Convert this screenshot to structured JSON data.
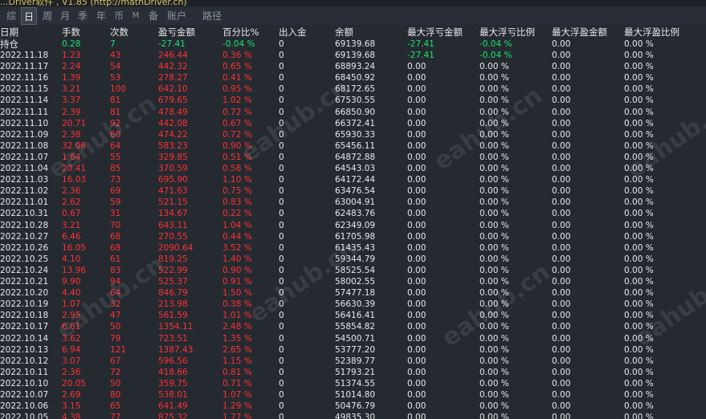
{
  "window": {
    "title": "...Driver软件 , V1.85 (http://mathDriver.cn)"
  },
  "tabs": [
    {
      "label": "综",
      "active": false
    },
    {
      "label": "日",
      "active": true
    },
    {
      "label": "周",
      "active": false
    },
    {
      "label": "月",
      "active": false
    },
    {
      "label": "季",
      "active": false
    },
    {
      "label": "年",
      "active": false
    },
    {
      "label": "币",
      "active": false
    },
    {
      "label": "M",
      "active": false
    },
    {
      "label": "备",
      "active": false
    },
    {
      "label": "账户",
      "active": false
    },
    {
      "label": "路径",
      "active": false
    }
  ],
  "columns": [
    "日期",
    "手数",
    "次数",
    "盈亏金额",
    "百分比%",
    "出入金",
    "余额",
    "最大浮亏金额",
    "最大浮亏比例",
    "最大浮盈金额",
    "最大浮盈比例"
  ],
  "holding_row": {
    "label": "持仓",
    "lots": "0.28",
    "count": "7",
    "pnl": "-27.41",
    "pct": "-0.04 %",
    "inout": "0",
    "balance": "69139.68",
    "max_loss_amt": "-27.41",
    "max_loss_pct": "-0.04 %",
    "max_gain_amt": "0.00",
    "max_gain_pct": "0.00 %"
  },
  "rows": [
    {
      "date": "2022.11.18",
      "lots": "1.23",
      "count": "43",
      "pnl": "246.44",
      "pct": "0.36 %",
      "inout": "0",
      "balance": "69139.68",
      "max_loss_amt": "-27.41",
      "max_loss_pct": "-0.04 %",
      "max_gain_amt": "0.00",
      "max_gain_pct": "0.00 %"
    },
    {
      "date": "2022.11.17",
      "lots": "2.24",
      "count": "54",
      "pnl": "442.32",
      "pct": "0.65 %",
      "inout": "0",
      "balance": "68893.24",
      "max_loss_amt": "0.00",
      "max_loss_pct": "0.00 %",
      "max_gain_amt": "0.00",
      "max_gain_pct": "0.00 %"
    },
    {
      "date": "2022.11.16",
      "lots": "1.39",
      "count": "53",
      "pnl": "278.27",
      "pct": "0.41 %",
      "inout": "0",
      "balance": "68450.92",
      "max_loss_amt": "0.00",
      "max_loss_pct": "0.00 %",
      "max_gain_amt": "0.00",
      "max_gain_pct": "0.00 %"
    },
    {
      "date": "2022.11.15",
      "lots": "3.21",
      "count": "100",
      "pnl": "642.10",
      "pct": "0.95 %",
      "inout": "0",
      "balance": "68172.65",
      "max_loss_amt": "0.00",
      "max_loss_pct": "0.00 %",
      "max_gain_amt": "0.00",
      "max_gain_pct": "0.00 %"
    },
    {
      "date": "2022.11.14",
      "lots": "3.37",
      "count": "81",
      "pnl": "679.65",
      "pct": "1.02 %",
      "inout": "0",
      "balance": "67530.55",
      "max_loss_amt": "0.00",
      "max_loss_pct": "0.00 %",
      "max_gain_amt": "0.00",
      "max_gain_pct": "0.00 %"
    },
    {
      "date": "2022.11.11",
      "lots": "2.39",
      "count": "81",
      "pnl": "478.49",
      "pct": "0.72 %",
      "inout": "0",
      "balance": "66850.90",
      "max_loss_amt": "0.00",
      "max_loss_pct": "0.00 %",
      "max_gain_amt": "0.00",
      "max_gain_pct": "0.00 %"
    },
    {
      "date": "2022.11.10",
      "lots": "20.71",
      "count": "92",
      "pnl": "442.08",
      "pct": "0.67 %",
      "inout": "0",
      "balance": "66372.41",
      "max_loss_amt": "0.00",
      "max_loss_pct": "0.00 %",
      "max_gain_amt": "0.00",
      "max_gain_pct": "0.00 %"
    },
    {
      "date": "2022.11.09",
      "lots": "2.38",
      "count": "60",
      "pnl": "474.22",
      "pct": "0.72 %",
      "inout": "0",
      "balance": "65930.33",
      "max_loss_amt": "0.00",
      "max_loss_pct": "0.00 %",
      "max_gain_amt": "0.00",
      "max_gain_pct": "0.00 %"
    },
    {
      "date": "2022.11.08",
      "lots": "32.06",
      "count": "64",
      "pnl": "583.23",
      "pct": "0.90 %",
      "inout": "0",
      "balance": "65456.11",
      "max_loss_amt": "0.00",
      "max_loss_pct": "0.00 %",
      "max_gain_amt": "0.00",
      "max_gain_pct": "0.00 %"
    },
    {
      "date": "2022.11.07",
      "lots": "1.64",
      "count": "55",
      "pnl": "329.85",
      "pct": "0.51 %",
      "inout": "0",
      "balance": "64872.88",
      "max_loss_amt": "0.00",
      "max_loss_pct": "0.00 %",
      "max_gain_amt": "0.00",
      "max_gain_pct": "0.00 %"
    },
    {
      "date": "2022.11.04",
      "lots": "20.41",
      "count": "85",
      "pnl": "370.59",
      "pct": "0.58 %",
      "inout": "0",
      "balance": "64543.03",
      "max_loss_amt": "0.00",
      "max_loss_pct": "0.00 %",
      "max_gain_amt": "0.00",
      "max_gain_pct": "0.00 %"
    },
    {
      "date": "2022.11.03",
      "lots": "16.03",
      "count": "73",
      "pnl": "695.90",
      "pct": "1.10 %",
      "inout": "0",
      "balance": "64172.44",
      "max_loss_amt": "0.00",
      "max_loss_pct": "0.00 %",
      "max_gain_amt": "0.00",
      "max_gain_pct": "0.00 %"
    },
    {
      "date": "2022.11.02",
      "lots": "2.36",
      "count": "69",
      "pnl": "471.63",
      "pct": "0.75 %",
      "inout": "0",
      "balance": "63476.54",
      "max_loss_amt": "0.00",
      "max_loss_pct": "0.00 %",
      "max_gain_amt": "0.00",
      "max_gain_pct": "0.00 %"
    },
    {
      "date": "2022.11.01",
      "lots": "2.62",
      "count": "59",
      "pnl": "521.15",
      "pct": "0.83 %",
      "inout": "0",
      "balance": "63004.91",
      "max_loss_amt": "0.00",
      "max_loss_pct": "0.00 %",
      "max_gain_amt": "0.00",
      "max_gain_pct": "0.00 %"
    },
    {
      "date": "2022.10.31",
      "lots": "0.67",
      "count": "31",
      "pnl": "134.67",
      "pct": "0.22 %",
      "inout": "0",
      "balance": "62483.76",
      "max_loss_amt": "0.00",
      "max_loss_pct": "0.00 %",
      "max_gain_amt": "0.00",
      "max_gain_pct": "0.00 %"
    },
    {
      "date": "2022.10.28",
      "lots": "3.21",
      "count": "70",
      "pnl": "643.11",
      "pct": "1.04 %",
      "inout": "0",
      "balance": "62349.09",
      "max_loss_amt": "0.00",
      "max_loss_pct": "0.00 %",
      "max_gain_amt": "0.00",
      "max_gain_pct": "0.00 %"
    },
    {
      "date": "2022.10.27",
      "lots": "6.46",
      "count": "68",
      "pnl": "270.55",
      "pct": "0.44 %",
      "inout": "0",
      "balance": "61705.98",
      "max_loss_amt": "0.00",
      "max_loss_pct": "0.00 %",
      "max_gain_amt": "0.00",
      "max_gain_pct": "0.00 %"
    },
    {
      "date": "2022.10.26",
      "lots": "16.05",
      "count": "68",
      "pnl": "2090.64",
      "pct": "3.52 %",
      "inout": "0",
      "balance": "61435.43",
      "max_loss_amt": "0.00",
      "max_loss_pct": "0.00 %",
      "max_gain_amt": "0.00",
      "max_gain_pct": "0.00 %"
    },
    {
      "date": "2022.10.25",
      "lots": "4.10",
      "count": "61",
      "pnl": "819.25",
      "pct": "1.40 %",
      "inout": "0",
      "balance": "59344.79",
      "max_loss_amt": "0.00",
      "max_loss_pct": "0.00 %",
      "max_gain_amt": "0.00",
      "max_gain_pct": "0.00 %"
    },
    {
      "date": "2022.10.24",
      "lots": "13.96",
      "count": "83",
      "pnl": "522.99",
      "pct": "0.90 %",
      "inout": "0",
      "balance": "58525.54",
      "max_loss_amt": "0.00",
      "max_loss_pct": "0.00 %",
      "max_gain_amt": "0.00",
      "max_gain_pct": "0.00 %"
    },
    {
      "date": "2022.10.21",
      "lots": "9.90",
      "count": "94",
      "pnl": "525.37",
      "pct": "0.91 %",
      "inout": "0",
      "balance": "58002.55",
      "max_loss_amt": "0.00",
      "max_loss_pct": "0.00 %",
      "max_gain_amt": "0.00",
      "max_gain_pct": "0.00 %"
    },
    {
      "date": "2022.10.20",
      "lots": "4.40",
      "count": "64",
      "pnl": "846.79",
      "pct": "1.50 %",
      "inout": "0",
      "balance": "57477.18",
      "max_loss_amt": "0.00",
      "max_loss_pct": "0.00 %",
      "max_gain_amt": "0.00",
      "max_gain_pct": "0.00 %"
    },
    {
      "date": "2022.10.19",
      "lots": "1.07",
      "count": "32",
      "pnl": "213.98",
      "pct": "0.38 %",
      "inout": "0",
      "balance": "56630.39",
      "max_loss_amt": "0.00",
      "max_loss_pct": "0.00 %",
      "max_gain_amt": "0.00",
      "max_gain_pct": "0.00 %"
    },
    {
      "date": "2022.10.18",
      "lots": "2.95",
      "count": "47",
      "pnl": "561.59",
      "pct": "1.01 %",
      "inout": "0",
      "balance": "56416.41",
      "max_loss_amt": "0.00",
      "max_loss_pct": "0.00 %",
      "max_gain_amt": "0.00",
      "max_gain_pct": "0.00 %"
    },
    {
      "date": "2022.10.17",
      "lots": "6.81",
      "count": "50",
      "pnl": "1354.11",
      "pct": "2.48 %",
      "inout": "0",
      "balance": "55854.82",
      "max_loss_amt": "0.00",
      "max_loss_pct": "0.00 %",
      "max_gain_amt": "0.00",
      "max_gain_pct": "0.00 %"
    },
    {
      "date": "2022.10.14",
      "lots": "3.62",
      "count": "79",
      "pnl": "723.51",
      "pct": "1.35 %",
      "inout": "0",
      "balance": "54500.71",
      "max_loss_amt": "0.00",
      "max_loss_pct": "0.00 %",
      "max_gain_amt": "0.00",
      "max_gain_pct": "0.00 %"
    },
    {
      "date": "2022.10.13",
      "lots": "6.94",
      "count": "121",
      "pnl": "1387.43",
      "pct": "2.65 %",
      "inout": "0",
      "balance": "53777.20",
      "max_loss_amt": "0.00",
      "max_loss_pct": "0.00 %",
      "max_gain_amt": "0.00",
      "max_gain_pct": "0.00 %"
    },
    {
      "date": "2022.10.12",
      "lots": "3.07",
      "count": "67",
      "pnl": "596.56",
      "pct": "1.15 %",
      "inout": "0",
      "balance": "52389.77",
      "max_loss_amt": "0.00",
      "max_loss_pct": "0.00 %",
      "max_gain_amt": "0.00",
      "max_gain_pct": "0.00 %"
    },
    {
      "date": "2022.10.11",
      "lots": "2.36",
      "count": "72",
      "pnl": "418.66",
      "pct": "0.81 %",
      "inout": "0",
      "balance": "51793.21",
      "max_loss_amt": "0.00",
      "max_loss_pct": "0.00 %",
      "max_gain_amt": "0.00",
      "max_gain_pct": "0.00 %"
    },
    {
      "date": "2022.10.10",
      "lots": "20.05",
      "count": "50",
      "pnl": "359.75",
      "pct": "0.71 %",
      "inout": "0",
      "balance": "51374.55",
      "max_loss_amt": "0.00",
      "max_loss_pct": "0.00 %",
      "max_gain_amt": "0.00",
      "max_gain_pct": "0.00 %"
    },
    {
      "date": "2022.10.07",
      "lots": "2.69",
      "count": "80",
      "pnl": "538.01",
      "pct": "1.07 %",
      "inout": "0",
      "balance": "51014.80",
      "max_loss_amt": "0.00",
      "max_loss_pct": "0.00 %",
      "max_gain_amt": "0.00",
      "max_gain_pct": "0.00 %"
    },
    {
      "date": "2022.10.06",
      "lots": "3.15",
      "count": "65",
      "pnl": "641.49",
      "pct": "1.29 %",
      "inout": "0",
      "balance": "50476.79",
      "max_loss_amt": "0.00",
      "max_loss_pct": "0.00 %",
      "max_gain_amt": "0.00",
      "max_gain_pct": "0.00 %"
    },
    {
      "date": "2022.10.05",
      "lots": "4.38",
      "count": "77",
      "pnl": "875.32",
      "pct": "1.77 %",
      "inout": "0",
      "balance": "49835.30",
      "max_loss_amt": "0.00",
      "max_loss_pct": "0.00 %",
      "max_gain_amt": "0.00",
      "max_gain_pct": "0.00 %"
    }
  ],
  "watermark": "eahub.cn",
  "colors": {
    "background": "#252a31",
    "profit": "#ff3030",
    "loss": "#19e36c",
    "text": "#e8e8e8"
  }
}
